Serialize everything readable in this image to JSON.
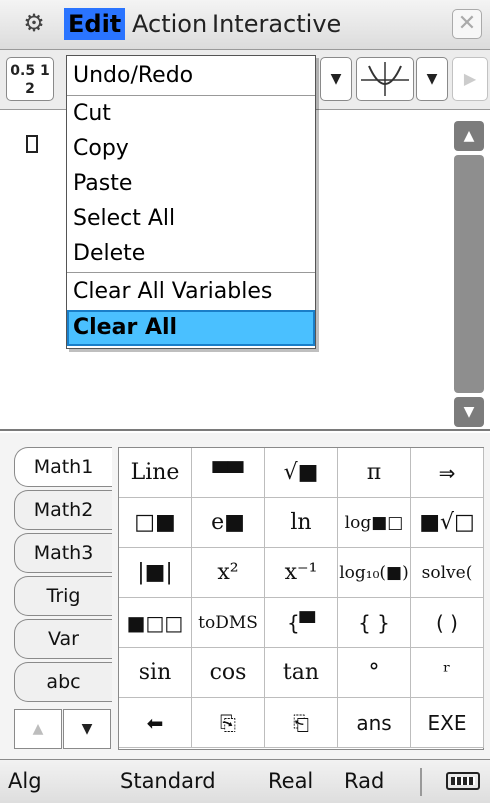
{
  "menubar": {
    "settings_icon": "gear-icon",
    "menus": [
      "Edit",
      "Action",
      "Interactive"
    ],
    "close_icon": "close-icon"
  },
  "toolbar": {
    "frac_icon_top": "0.5 1",
    "frac_icon_bottom": "2",
    "dropdown_arrow": "▼",
    "play_arrow": "▶"
  },
  "workarea": {
    "scroll_up": "▲",
    "scroll_down": "▼"
  },
  "edit_menu": {
    "items": [
      "Undo/Redo",
      "Cut",
      "Copy",
      "Paste",
      "Select All",
      "Delete",
      "Clear All Variables",
      "Clear All"
    ],
    "selected": "Clear All"
  },
  "keyboard": {
    "tabs": [
      "Math1",
      "Math2",
      "Math3",
      "Trig",
      "Var",
      "abc"
    ],
    "active_tab": "Math1",
    "nav_up": "▲",
    "nav_down": "▼",
    "keys": [
      [
        "Line",
        "▀▀",
        "√■",
        "π",
        "⇒"
      ],
      [
        "□■",
        "e■",
        "ln",
        "log■□",
        "■√□"
      ],
      [
        "|■|",
        "x²",
        "x⁻¹",
        "log₁₀(■)",
        "solve("
      ],
      [
        "■□□",
        "toDMS",
        "{▀",
        "{ }",
        "( )"
      ],
      [
        "sin",
        "cos",
        "tan",
        "°",
        "ʳ"
      ],
      [
        "⬅",
        "⎘",
        "⎗",
        "ans",
        "EXE"
      ]
    ]
  },
  "statusbar": {
    "mode": "Alg",
    "format": "Standard",
    "number": "Real",
    "angle": "Rad"
  }
}
